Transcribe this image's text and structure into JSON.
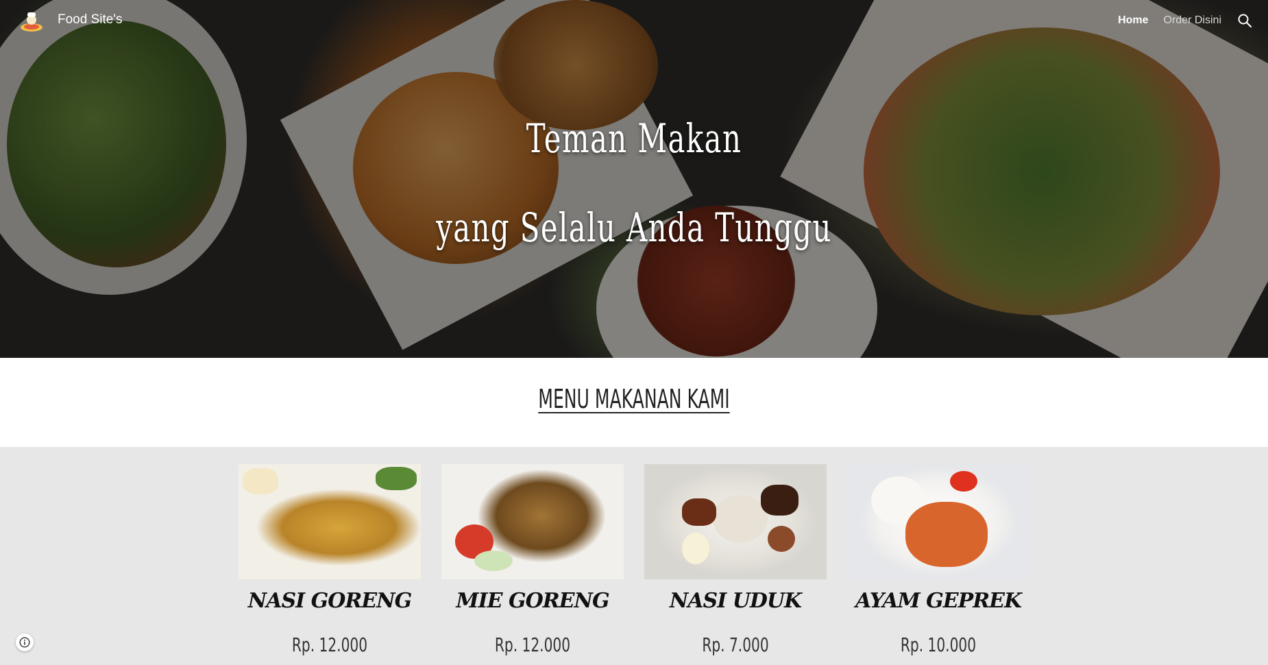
{
  "header": {
    "site_title": "Food Site's",
    "logo_icon": "chef-logo-icon",
    "nav": [
      {
        "label": "Home",
        "active": true
      },
      {
        "label": "Order Disini",
        "active": false
      }
    ],
    "search_icon": "search-icon"
  },
  "hero": {
    "line1": "Teman Makan",
    "line2": "yang Selalu Anda Tunggu"
  },
  "menu": {
    "heading": "MENU MAKANAN KAMI",
    "items": [
      {
        "name": "NASI GORENG",
        "price": "Rp. 12.000"
      },
      {
        "name": "MIE GORENG",
        "price": "Rp. 12.000"
      },
      {
        "name": "NASI UDUK",
        "price": "Rp. 7.000"
      },
      {
        "name": "AYAM GEPREK",
        "price": "Rp. 10.000"
      }
    ]
  },
  "footer": {
    "info_icon": "info-icon"
  },
  "colors": {
    "hero_overlay": "#000000",
    "menu_background": "#e7e7e7",
    "text_white": "#ffffff"
  }
}
